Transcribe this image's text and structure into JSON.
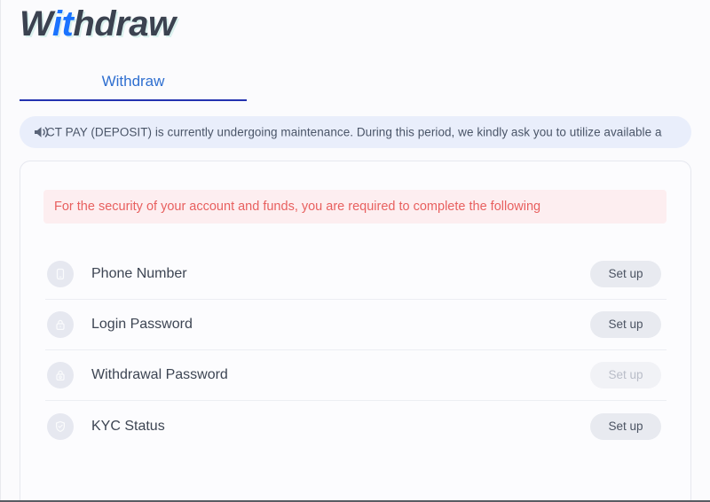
{
  "header": {
    "title_segments": [
      {
        "text": "W",
        "color": "#3b4250"
      },
      {
        "text": "it",
        "color": "#1a73ff"
      },
      {
        "text": "hdraw",
        "color": "#3b4250"
      }
    ],
    "title_full": "Withdraw"
  },
  "tabs": [
    {
      "label": "Withdraw",
      "active": true
    }
  ],
  "notice": {
    "icon": "speaker-icon",
    "text": "CT PAY (DEPOSIT) is currently undergoing maintenance. During this period, we kindly ask you to utilize available a"
  },
  "alert": {
    "text": "For the security of your account and funds, you are required to complete the following",
    "color": "#e8605f",
    "background": "#fdeef0"
  },
  "security_items": [
    {
      "icon": "mobile-phone-icon",
      "label": "Phone Number",
      "action_label": "Set up",
      "disabled": false
    },
    {
      "icon": "lock-icon",
      "label": "Login Password",
      "action_label": "Set up",
      "disabled": false
    },
    {
      "icon": "lock-keyhole-icon",
      "label": "Withdrawal Password",
      "action_label": "Set up",
      "disabled": true
    },
    {
      "icon": "shield-check-icon",
      "label": "KYC Status",
      "action_label": "Set up",
      "disabled": false
    }
  ],
  "colors": {
    "accent_blue": "#1a73ff",
    "tab_blue": "#2f6fd0",
    "tab_underline": "#2433b0",
    "notice_bg": "#e9eefb",
    "alert_red": "#e8605f",
    "page_bg": "#fbfbfd"
  }
}
